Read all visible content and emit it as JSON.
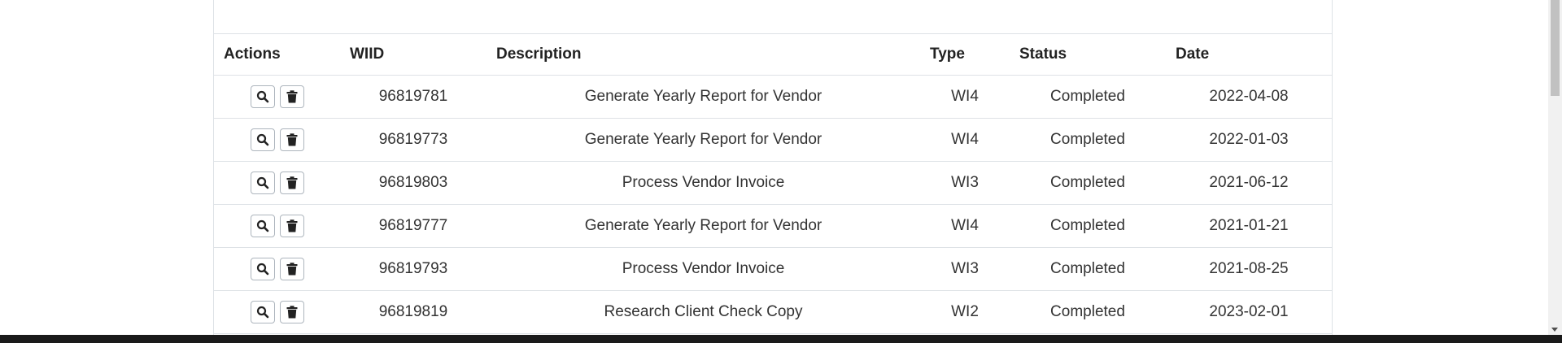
{
  "table": {
    "headers": {
      "actions": "Actions",
      "wiid": "WIID",
      "description": "Description",
      "type": "Type",
      "status": "Status",
      "date": "Date"
    },
    "rows": [
      {
        "wiid": "96819781",
        "description": "Generate Yearly Report for Vendor",
        "type": "WI4",
        "status": "Completed",
        "date": "2022-04-08"
      },
      {
        "wiid": "96819773",
        "description": "Generate Yearly Report for Vendor",
        "type": "WI4",
        "status": "Completed",
        "date": "2022-01-03"
      },
      {
        "wiid": "96819803",
        "description": "Process Vendor Invoice",
        "type": "WI3",
        "status": "Completed",
        "date": "2021-06-12"
      },
      {
        "wiid": "96819777",
        "description": "Generate Yearly Report for Vendor",
        "type": "WI4",
        "status": "Completed",
        "date": "2021-01-21"
      },
      {
        "wiid": "96819793",
        "description": "Process Vendor Invoice",
        "type": "WI3",
        "status": "Completed",
        "date": "2021-08-25"
      },
      {
        "wiid": "96819819",
        "description": "Research Client Check Copy",
        "type": "WI2",
        "status": "Completed",
        "date": "2023-02-01"
      }
    ]
  },
  "icons": {
    "view": "search-icon",
    "delete": "trash-icon"
  }
}
